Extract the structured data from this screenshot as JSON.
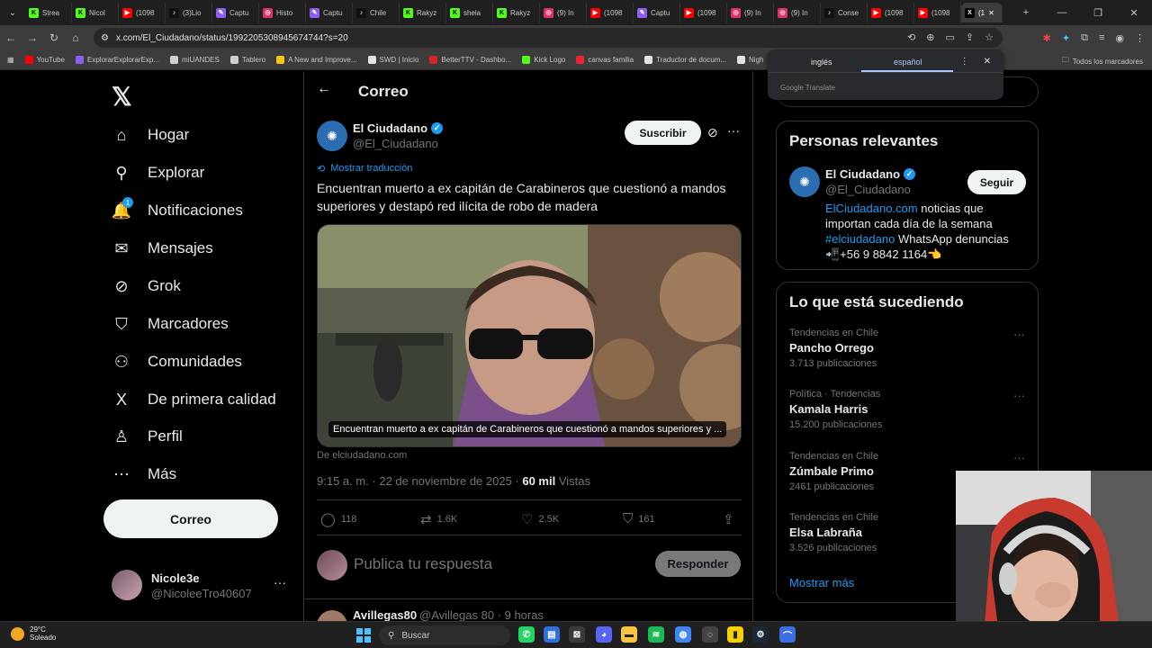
{
  "browser": {
    "tabs": [
      {
        "label": "Strea",
        "icon": "kick-icon",
        "color": "#53fc18",
        "glyph": "K"
      },
      {
        "label": "Nicol",
        "icon": "kick-icon",
        "color": "#53fc18",
        "glyph": "K"
      },
      {
        "label": "(1098",
        "icon": "youtube-icon",
        "color": "#ff0000",
        "glyph": "▶"
      },
      {
        "label": "(3)Lio",
        "icon": "tiktok-icon",
        "color": "#111111",
        "glyph": "♪"
      },
      {
        "label": "Captu",
        "icon": "editor-icon",
        "color": "#8e5cf7",
        "glyph": "✎"
      },
      {
        "label": "Histo",
        "icon": "instagram-icon",
        "color": "#e1306c",
        "glyph": "◎"
      },
      {
        "label": "Captu",
        "icon": "editor-icon",
        "color": "#8e5cf7",
        "glyph": "✎"
      },
      {
        "label": "Chile",
        "icon": "tiktok-icon",
        "color": "#111111",
        "glyph": "♪"
      },
      {
        "label": "Rakyz",
        "icon": "kick-icon",
        "color": "#53fc18",
        "glyph": "K"
      },
      {
        "label": "shela",
        "icon": "kick-icon",
        "color": "#53fc18",
        "glyph": "K"
      },
      {
        "label": "Rakyz",
        "icon": "kick-icon",
        "color": "#53fc18",
        "glyph": "K"
      },
      {
        "label": "(9) In",
        "icon": "instagram-icon",
        "color": "#e1306c",
        "glyph": "◎"
      },
      {
        "label": "(1098",
        "icon": "youtube-icon",
        "color": "#ff0000",
        "glyph": "▶"
      },
      {
        "label": "Captu",
        "icon": "editor-icon",
        "color": "#8e5cf7",
        "glyph": "✎"
      },
      {
        "label": "(1098",
        "icon": "youtube-icon",
        "color": "#ff0000",
        "glyph": "▶"
      },
      {
        "label": "(9) In",
        "icon": "instagram-icon",
        "color": "#e1306c",
        "glyph": "◎"
      },
      {
        "label": "(9) In",
        "icon": "instagram-icon",
        "color": "#e1306c",
        "glyph": "◎"
      },
      {
        "label": "Conse",
        "icon": "tiktok-icon",
        "color": "#111111",
        "glyph": "♪"
      },
      {
        "label": "(1098",
        "icon": "youtube-icon",
        "color": "#ff0000",
        "glyph": "▶"
      },
      {
        "label": "(1098",
        "icon": "youtube-icon",
        "color": "#ff0000",
        "glyph": "▶"
      },
      {
        "label": "(1",
        "icon": "x-icon",
        "color": "#000000",
        "glyph": "X",
        "active": true
      }
    ],
    "url": "x.com/El_Ciudadano/status/1992205308945674744?s=20",
    "bookmarks": [
      {
        "label": "YouTube",
        "color": "#ff0000"
      },
      {
        "label": "ExplorarExplorarExp...",
        "color": "#8e5cf7"
      },
      {
        "label": "miUANDES",
        "color": "#cfcfcf"
      },
      {
        "label": "Tablero",
        "color": "#cfcfcf"
      },
      {
        "label": "A New and Improve...",
        "color": "#f5c518"
      },
      {
        "label": "SWD | Inicio",
        "color": "#e3e3e3"
      },
      {
        "label": "BetterTTV - Dashbo...",
        "color": "#d22"
      },
      {
        "label": "Kick Logo",
        "color": "#53fc18"
      },
      {
        "label": "canvas familia",
        "color": "#e23"
      },
      {
        "label": "Traductor de docum...",
        "color": "#e3e3e3"
      },
      {
        "label": "Nigh",
        "color": "#e3e3e3"
      }
    ],
    "all_bookmarks": "Todos los marcadores"
  },
  "translate_popup": {
    "lang_source": "inglés",
    "lang_target": "español",
    "footer": "Google Translate"
  },
  "sidebar": {
    "items": [
      {
        "label": "Hogar",
        "icon": "home-icon",
        "glyph": "⌂"
      },
      {
        "label": "Explorar",
        "icon": "search-icon",
        "glyph": "⚲"
      },
      {
        "label": "Notificaciones",
        "icon": "bell-icon",
        "glyph": "🔔",
        "badge": "1"
      },
      {
        "label": "Mensajes",
        "icon": "mail-icon",
        "glyph": "✉"
      },
      {
        "label": "Grok",
        "icon": "grok-icon",
        "glyph": "⊘"
      },
      {
        "label": "Marcadores",
        "icon": "bookmark-icon",
        "glyph": "⛉"
      },
      {
        "label": "Comunidades",
        "icon": "communities-icon",
        "glyph": "⚇"
      },
      {
        "label": "De primera calidad",
        "icon": "x-premium-icon",
        "glyph": "X"
      },
      {
        "label": "Perfil",
        "icon": "profile-icon",
        "glyph": "♙"
      },
      {
        "label": "Más",
        "icon": "more-circle-icon",
        "glyph": "⋯"
      }
    ],
    "post_button": "Correo",
    "account": {
      "name": "Nicole3e",
      "handle": "@NicoleeTro40607"
    }
  },
  "main": {
    "header_title": "Correo",
    "post": {
      "author": "El Ciudadano",
      "handle": "@El_Ciudadano",
      "subscribe": "Suscribir",
      "translate": "Mostrar traducción",
      "text": "Encuentran muerto a ex capitán de Carabineros que cuestionó a mandos superiores y destapó red ilícita de robo de madera",
      "card_caption": "Encuentran muerto a ex capitán de Carabineros que cuestionó a mandos superiores y ...",
      "card_source": "De elciudadano.com",
      "time": "9:15 a. m. · 22 de noviembre de 2025 · ",
      "views_count": "60 mil",
      "views_label": " Vistas",
      "stats": {
        "replies": "118",
        "reposts": "1.6K",
        "likes": "2.5K",
        "bookmarks": "161"
      }
    },
    "reply_placeholder": "Publica tu respuesta",
    "reply_button": "Responder",
    "next_reply": {
      "name": "Avillegas80",
      "handle": "@Avillegas 80 · 9 horas"
    }
  },
  "aside": {
    "relevant_title": "Personas relevantes",
    "person": {
      "name": "El Ciudadano",
      "handle": "@El_Ciudadano",
      "follow": "Seguir",
      "bio_link": "ElCiudadano.com",
      "bio_text1": " noticias que importan cada día de la semana ",
      "bio_hashtag": "#elciudadano",
      "bio_text2": " WhatsApp denuncias 📲+56 9 8842 1164👈"
    },
    "trending_title": "Lo que está sucediendo",
    "trends": [
      {
        "category": "Tendencias en Chile",
        "name": "Pancho Orrego",
        "count": "3.713 publicaciones"
      },
      {
        "category": "Política · Tendencias",
        "name": "Kamala Harris",
        "count": "15.200 publicaciones"
      },
      {
        "category": "Tendencias en Chile",
        "name": "Zúmbale Primo",
        "count": "2461 publicaciones"
      },
      {
        "category": "Tendencias en Chile",
        "name": "Elsa Labraña",
        "count": "3.526 publicaciones"
      }
    ],
    "show_more": "Mostrar más"
  },
  "taskbar": {
    "temperature": "29°C",
    "weather": "Soleado",
    "search": "Buscar"
  }
}
